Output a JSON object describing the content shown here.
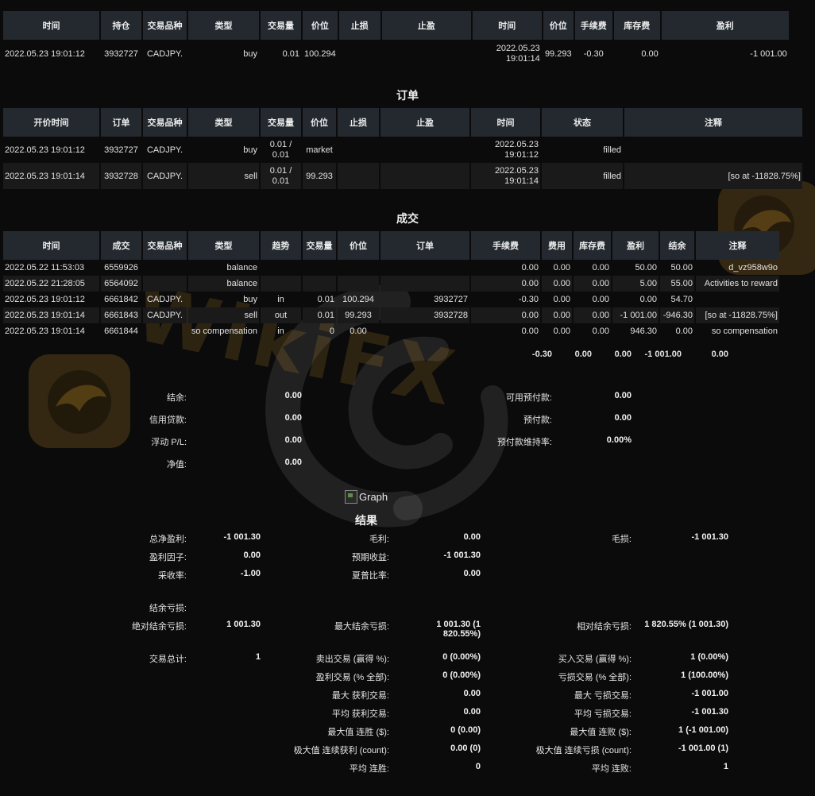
{
  "positions": {
    "headers": [
      "时间",
      "持仓",
      "交易品种",
      "类型",
      "交易量",
      "价位",
      "止损",
      "止盈",
      "时间",
      "价位",
      "手续费",
      "库存费",
      "盈利"
    ],
    "rows": [
      [
        "2022.05.23 19:01:12",
        "3932727",
        "CADJPY.",
        "buy",
        "0.01",
        "100.294",
        "",
        "",
        "2022.05.23 19:01:14",
        "99.293",
        "-0.30",
        "0.00",
        "-1 001.00"
      ]
    ]
  },
  "orders": {
    "title": "订单",
    "headers": [
      "开价时间",
      "订单",
      "交易品种",
      "类型",
      "交易量",
      "价位",
      "止损",
      "止盈",
      "时间",
      "状态",
      "注释"
    ],
    "rows": [
      [
        "2022.05.23 19:01:12",
        "3932727",
        "CADJPY.",
        "buy",
        "0.01 / 0.01",
        "market",
        "",
        "",
        "2022.05.23 19:01:12",
        "filled",
        ""
      ],
      [
        "2022.05.23 19:01:14",
        "3932728",
        "CADJPY.",
        "sell",
        "0.01 / 0.01",
        "99.293",
        "",
        "",
        "2022.05.23 19:01:14",
        "filled",
        "[so at -11828.75%]"
      ]
    ]
  },
  "deals": {
    "title": "成交",
    "headers": [
      "时间",
      "成交",
      "交易品种",
      "类型",
      "趋势",
      "交易量",
      "价位",
      "订单",
      "手续费",
      "费用",
      "库存费",
      "盈利",
      "结余",
      "注释"
    ],
    "rows": [
      [
        "2022.05.22 11:53:03",
        "6559926",
        "",
        "balance",
        "",
        "",
        "",
        "",
        "0.00",
        "0.00",
        "0.00",
        "50.00",
        "50.00",
        "d_vz958w9o"
      ],
      [
        "2022.05.22 21:28:05",
        "6564092",
        "",
        "balance",
        "",
        "",
        "",
        "",
        "0.00",
        "0.00",
        "0.00",
        "5.00",
        "55.00",
        "Activities to reward"
      ],
      [
        "2022.05.23 19:01:12",
        "6661842",
        "CADJPY.",
        "buy",
        "in",
        "0.01",
        "100.294",
        "3932727",
        "-0.30",
        "0.00",
        "0.00",
        "0.00",
        "54.70",
        ""
      ],
      [
        "2022.05.23 19:01:14",
        "6661843",
        "CADJPY.",
        "sell",
        "out",
        "0.01",
        "99.293",
        "3932728",
        "0.00",
        "0.00",
        "0.00",
        "-1 001.00",
        "-946.30",
        "[so at -11828.75%]"
      ],
      [
        "2022.05.23 19:01:14",
        "6661844",
        "",
        "so compensation",
        "in",
        "0",
        "0.00",
        "",
        "0.00",
        "0.00",
        "0.00",
        "946.30",
        "0.00",
        "so compensation"
      ]
    ],
    "totals": {
      "commission": "-0.30",
      "fee": "0.00",
      "swap": "0.00",
      "profit": "-1 001.00",
      "balance": "0.00"
    }
  },
  "account": {
    "balance_label": "结余:",
    "balance": "0.00",
    "credit_label": "信用贷款:",
    "credit": "0.00",
    "floating_label": "浮动 P/L:",
    "floating": "0.00",
    "equity_label": "净值:",
    "equity": "0.00",
    "free_margin_label": "可用预付款:",
    "free_margin": "0.00",
    "margin_label": "预付款:",
    "margin": "0.00",
    "margin_level_label": "预付款维持率:",
    "margin_level": "0.00%"
  },
  "graph_alt": "Graph",
  "results": {
    "title": "结果",
    "net_profit_label": "总净盈利:",
    "net_profit": "-1 001.30",
    "gross_profit_label": "毛利:",
    "gross_profit": "0.00",
    "gross_loss_label": "毛损:",
    "gross_loss": "-1 001.30",
    "profit_factor_label": "盈利因子:",
    "profit_factor": "0.00",
    "expected_payoff_label": "预期收益:",
    "expected_payoff": "-1 001.30",
    "recovery_factor_label": "采收率:",
    "recovery_factor": "-1.00",
    "sharpe_label": "夏普比率:",
    "sharpe": "0.00",
    "drawdown_label": "结余亏损:",
    "abs_dd_label": "绝对结余亏损:",
    "abs_dd": "1 001.30",
    "max_dd_label": "最大结余亏损:",
    "max_dd": "1 001.30 (1 820.55%)",
    "rel_dd_label": "相对结余亏损:",
    "rel_dd": "1 820.55% (1 001.30)",
    "total_trades_label": "交易总计:",
    "total_trades": "1",
    "short_label": "卖出交易 (赢得 %):",
    "short": "0 (0.00%)",
    "long_label": "买入交易 (赢得 %):",
    "long": "1 (0.00%)",
    "profit_trades_label": "盈利交易 (% 全部):",
    "profit_trades": "0 (0.00%)",
    "loss_trades_label": "亏损交易 (% 全部):",
    "loss_trades": "1 (100.00%)",
    "largest_profit_label": "最大 获利交易:",
    "largest_profit": "0.00",
    "largest_loss_label": "最大 亏损交易:",
    "largest_loss": "-1 001.00",
    "avg_profit_label": "平均 获利交易:",
    "avg_profit": "0.00",
    "avg_loss_label": "平均 亏损交易:",
    "avg_loss": "-1 001.30",
    "max_cons_wins_label": "最大值 连胜 ($):",
    "max_cons_wins": "0 (0.00)",
    "max_cons_losses_label": "最大值 连败 ($):",
    "max_cons_losses": "1 (-1 001.00)",
    "max_cons_profit_label": "极大值 连续获利 (count):",
    "max_cons_profit": "0.00 (0)",
    "max_cons_loss_label": "极大值 连续亏损 (count):",
    "max_cons_loss": "-1 001.00 (1)",
    "avg_cons_wins_label": "平均 连胜:",
    "avg_cons_wins": "0",
    "avg_cons_losses_label": "平均 连败:",
    "avg_cons_losses": "1"
  },
  "watermark": {
    "text": "WikiFX",
    "color": "#c8922a"
  }
}
